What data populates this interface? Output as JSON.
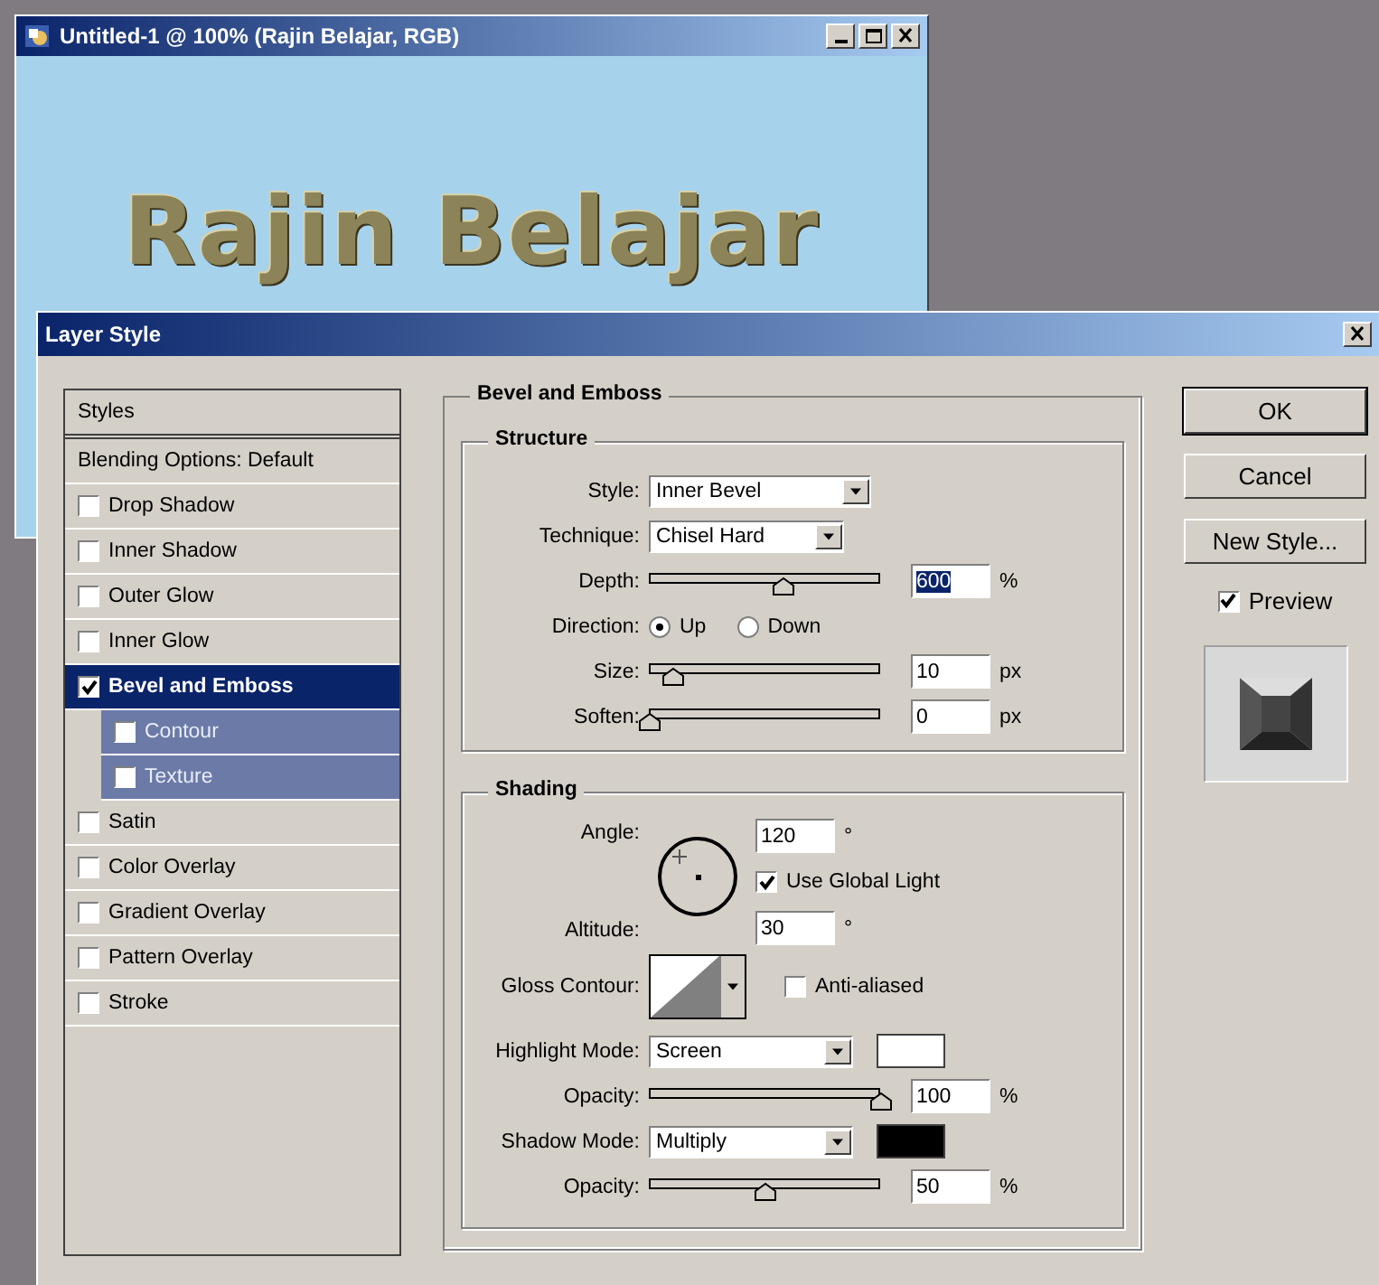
{
  "document_window": {
    "title": "Untitled-1 @ 100% (Rajin Belajar, RGB)",
    "canvas_text": "Rajin Belajar"
  },
  "dialog": {
    "title": "Layer Style"
  },
  "styles_list": {
    "header": "Styles",
    "items": [
      {
        "label": "Blending Options: Default",
        "kind": "plain",
        "selected": false
      },
      {
        "label": "Drop Shadow",
        "kind": "check",
        "checked": false,
        "selected": false
      },
      {
        "label": "Inner Shadow",
        "kind": "check",
        "checked": false,
        "selected": false
      },
      {
        "label": "Outer Glow",
        "kind": "check",
        "checked": false,
        "selected": false
      },
      {
        "label": "Inner Glow",
        "kind": "check",
        "checked": false,
        "selected": false
      },
      {
        "label": "Bevel and Emboss",
        "kind": "check",
        "checked": true,
        "selected": true,
        "children": [
          {
            "label": "Contour",
            "kind": "check",
            "checked": false,
            "selected": false
          },
          {
            "label": "Texture",
            "kind": "check",
            "checked": false,
            "selected": false
          }
        ]
      },
      {
        "label": "Satin",
        "kind": "check",
        "checked": false,
        "selected": false
      },
      {
        "label": "Color Overlay",
        "kind": "check",
        "checked": false,
        "selected": false
      },
      {
        "label": "Gradient Overlay",
        "kind": "check",
        "checked": false,
        "selected": false
      },
      {
        "label": "Pattern Overlay",
        "kind": "check",
        "checked": false,
        "selected": false
      },
      {
        "label": "Stroke",
        "kind": "check",
        "checked": false,
        "selected": false
      }
    ]
  },
  "panel": {
    "title": "Bevel and Emboss",
    "structure": {
      "title": "Structure",
      "style": {
        "label": "Style:",
        "value": "Inner Bevel"
      },
      "technique": {
        "label": "Technique:",
        "value": "Chisel Hard"
      },
      "depth": {
        "label": "Depth:",
        "level": 0.58,
        "value": "600",
        "unit": "%",
        "text_selected": true
      },
      "direction": {
        "label": "Direction:",
        "options": [
          {
            "label": "Up",
            "selected": true
          },
          {
            "label": "Down",
            "selected": false
          }
        ]
      },
      "size": {
        "label": "Size:",
        "level": 0.1,
        "value": "10",
        "unit": "px",
        "text_selected": false
      },
      "soften": {
        "label": "Soften:",
        "level": 0,
        "value": "0",
        "unit": "px",
        "text_selected": false
      }
    },
    "shading": {
      "title": "Shading",
      "angle": {
        "label": "Angle:",
        "value": "120",
        "unit": "°"
      },
      "global_light": {
        "label": "Use Global Light",
        "checked": true
      },
      "altitude": {
        "label": "Altitude:",
        "value": "30",
        "unit": "°"
      },
      "gloss_contour": {
        "label": "Gloss Contour:"
      },
      "anti_aliased": {
        "label": "Anti-aliased",
        "checked": false
      },
      "highlight_mode": {
        "label": "Highlight Mode:",
        "value": "Screen",
        "color": "#ffffff"
      },
      "highlight_opacity": {
        "label": "Opacity:",
        "level": 1,
        "value": "100",
        "unit": "%",
        "text_selected": false
      },
      "shadow_mode": {
        "label": "Shadow Mode:",
        "value": "Multiply",
        "color": "#000000"
      },
      "shadow_opacity": {
        "label": "Opacity:",
        "level": 0.5,
        "value": "50",
        "unit": "%",
        "text_selected": false
      }
    }
  },
  "buttons": [
    {
      "label": "OK",
      "default": true
    },
    {
      "label": "Cancel",
      "default": false
    },
    {
      "label": "New Style...",
      "default": false
    }
  ],
  "preview": {
    "label": "Preview",
    "checked": true
  }
}
